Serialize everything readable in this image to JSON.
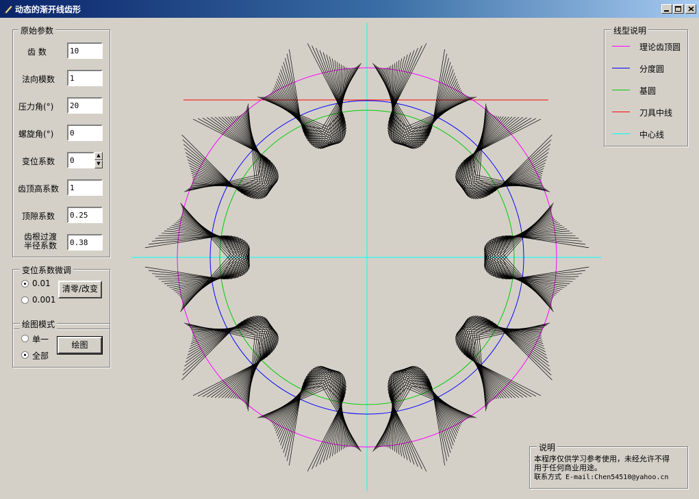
{
  "window": {
    "title": "动态的渐开线齿形"
  },
  "params": {
    "group_title": "原始参数",
    "fields": [
      {
        "label": "齿  数",
        "value": "10"
      },
      {
        "label": "法向模数",
        "value": "1"
      },
      {
        "label": "压力角(°)",
        "value": "20"
      },
      {
        "label": "螺旋角(°)",
        "value": "0"
      },
      {
        "label": "变位系数",
        "value": "0"
      },
      {
        "label": "齿顶高系数",
        "value": "1"
      },
      {
        "label": "顶隙系数",
        "value": "0.25"
      },
      {
        "label": "齿根过渡\n半径系数",
        "value": "0.38"
      }
    ]
  },
  "tuning": {
    "group_title": "变位系数微调",
    "opt1": "0.01",
    "opt2": "0.001",
    "selected": "0.01",
    "button": "清零/改变"
  },
  "mode": {
    "group_title": "绘图模式",
    "opt1": "单一",
    "opt2": "全部",
    "selected": "全部",
    "button": "绘图"
  },
  "legend": {
    "group_title": "线型说明",
    "items": [
      {
        "label": "理论齿顶圆",
        "color": "#ff00ff"
      },
      {
        "label": "分度圆",
        "color": "#0000ff"
      },
      {
        "label": "基圆",
        "color": "#00cc00"
      },
      {
        "label": "刀具中线",
        "color": "#ff0000"
      },
      {
        "label": "中心线",
        "color": "#00ffff"
      }
    ]
  },
  "note": {
    "group_title": "说明",
    "line1": "本程序仅供学习参考使用，未经允许不得",
    "line2": "用于任何商业用途。",
    "line3": "联系方式 E-mail:Chen54510@yahoo.cn"
  },
  "gear": {
    "teeth": 10
  }
}
